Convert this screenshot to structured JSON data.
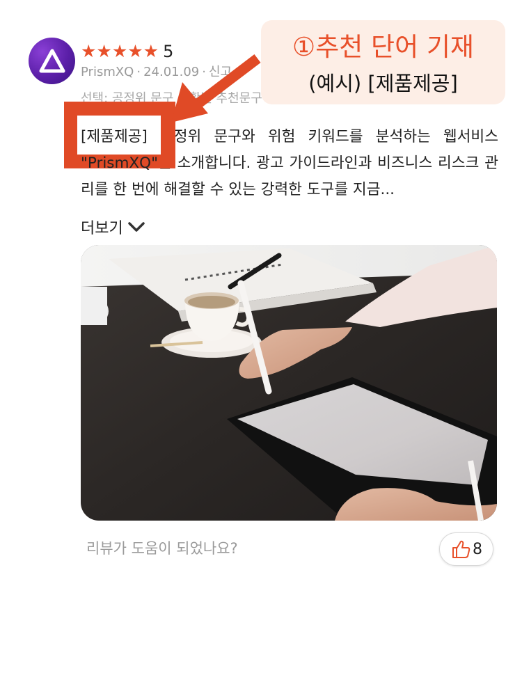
{
  "review": {
    "rating_stars": "★★★★★",
    "rating_value": "5",
    "author": "PrismXQ",
    "date": "24.01.09",
    "report_label": "신고",
    "option_text": "선택: 공정위 문구 상황별 추천문구",
    "body": "[제품제공] 공정위 문구와 위험 키워드를 분석하는 웹서비스 \"PrismXQ\"를 소개합니다. 광고 가이드라인과 비즈니스 리스크 관리를 한 번에 해결할 수 있는 강력한 도구를 지금...",
    "more_label": "더보기",
    "helpful_question": "리뷰가 도움이 되었나요?",
    "like_count": "8"
  },
  "annotation": {
    "title": "①추천 단어 기재",
    "subtitle": "(예시) [제품제공]",
    "highlight_text": "[제품제공]",
    "spill_text": "\"PrismXQ\""
  },
  "colors": {
    "accent": "#e8502a",
    "callout_bg": "#fdeee6",
    "avatar": "#5b1fa8"
  },
  "icons": {
    "avatar": "prism-triangle-icon",
    "more": "chevron-down-icon",
    "like": "thumbs-up-icon"
  }
}
